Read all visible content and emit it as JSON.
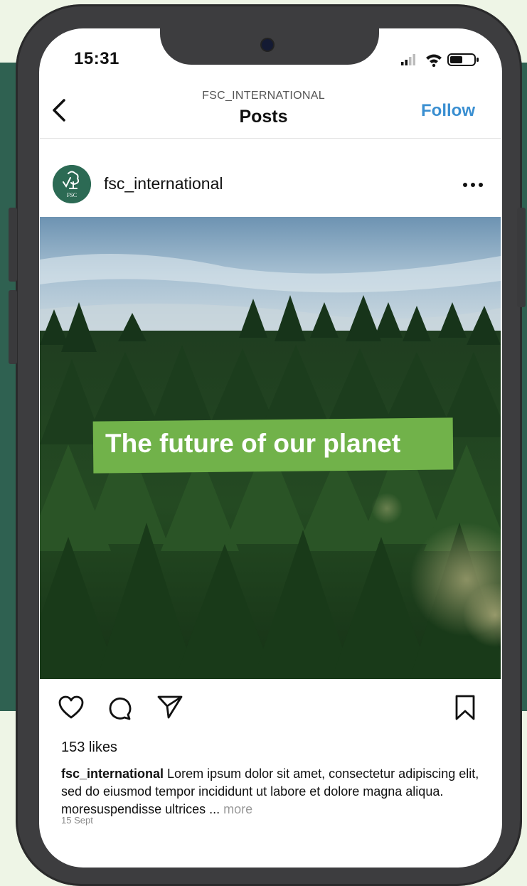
{
  "status_bar": {
    "time": "15:31"
  },
  "header": {
    "subtitle": "FSC_INTERNATIONAL",
    "title": "Posts",
    "follow_label": "Follow"
  },
  "post": {
    "username": "fsc_international",
    "avatar_logo_text": "FSC",
    "image_banner_text": "The future of our planet",
    "likes": "153 likes",
    "caption_user": "fsc_international",
    "caption_text": " Lorem ipsum dolor sit amet, consectetur adipiscing elit, sed do eiusmod tempor incididunt ut labore et dolore magna aliqua.  moresuspendisse ultrices ...",
    "more_label": "more",
    "date": "15 Sept"
  },
  "icons": {
    "back": "chevron-left-icon",
    "options": "more-horizontal-icon",
    "like": "heart-icon",
    "comment": "comment-icon",
    "share": "send-icon",
    "save": "bookmark-icon"
  },
  "colors": {
    "accent": "#3a8fd1",
    "banner": "#71b24a",
    "brand_green": "#2c6a54",
    "background_band": "#2f6151"
  }
}
